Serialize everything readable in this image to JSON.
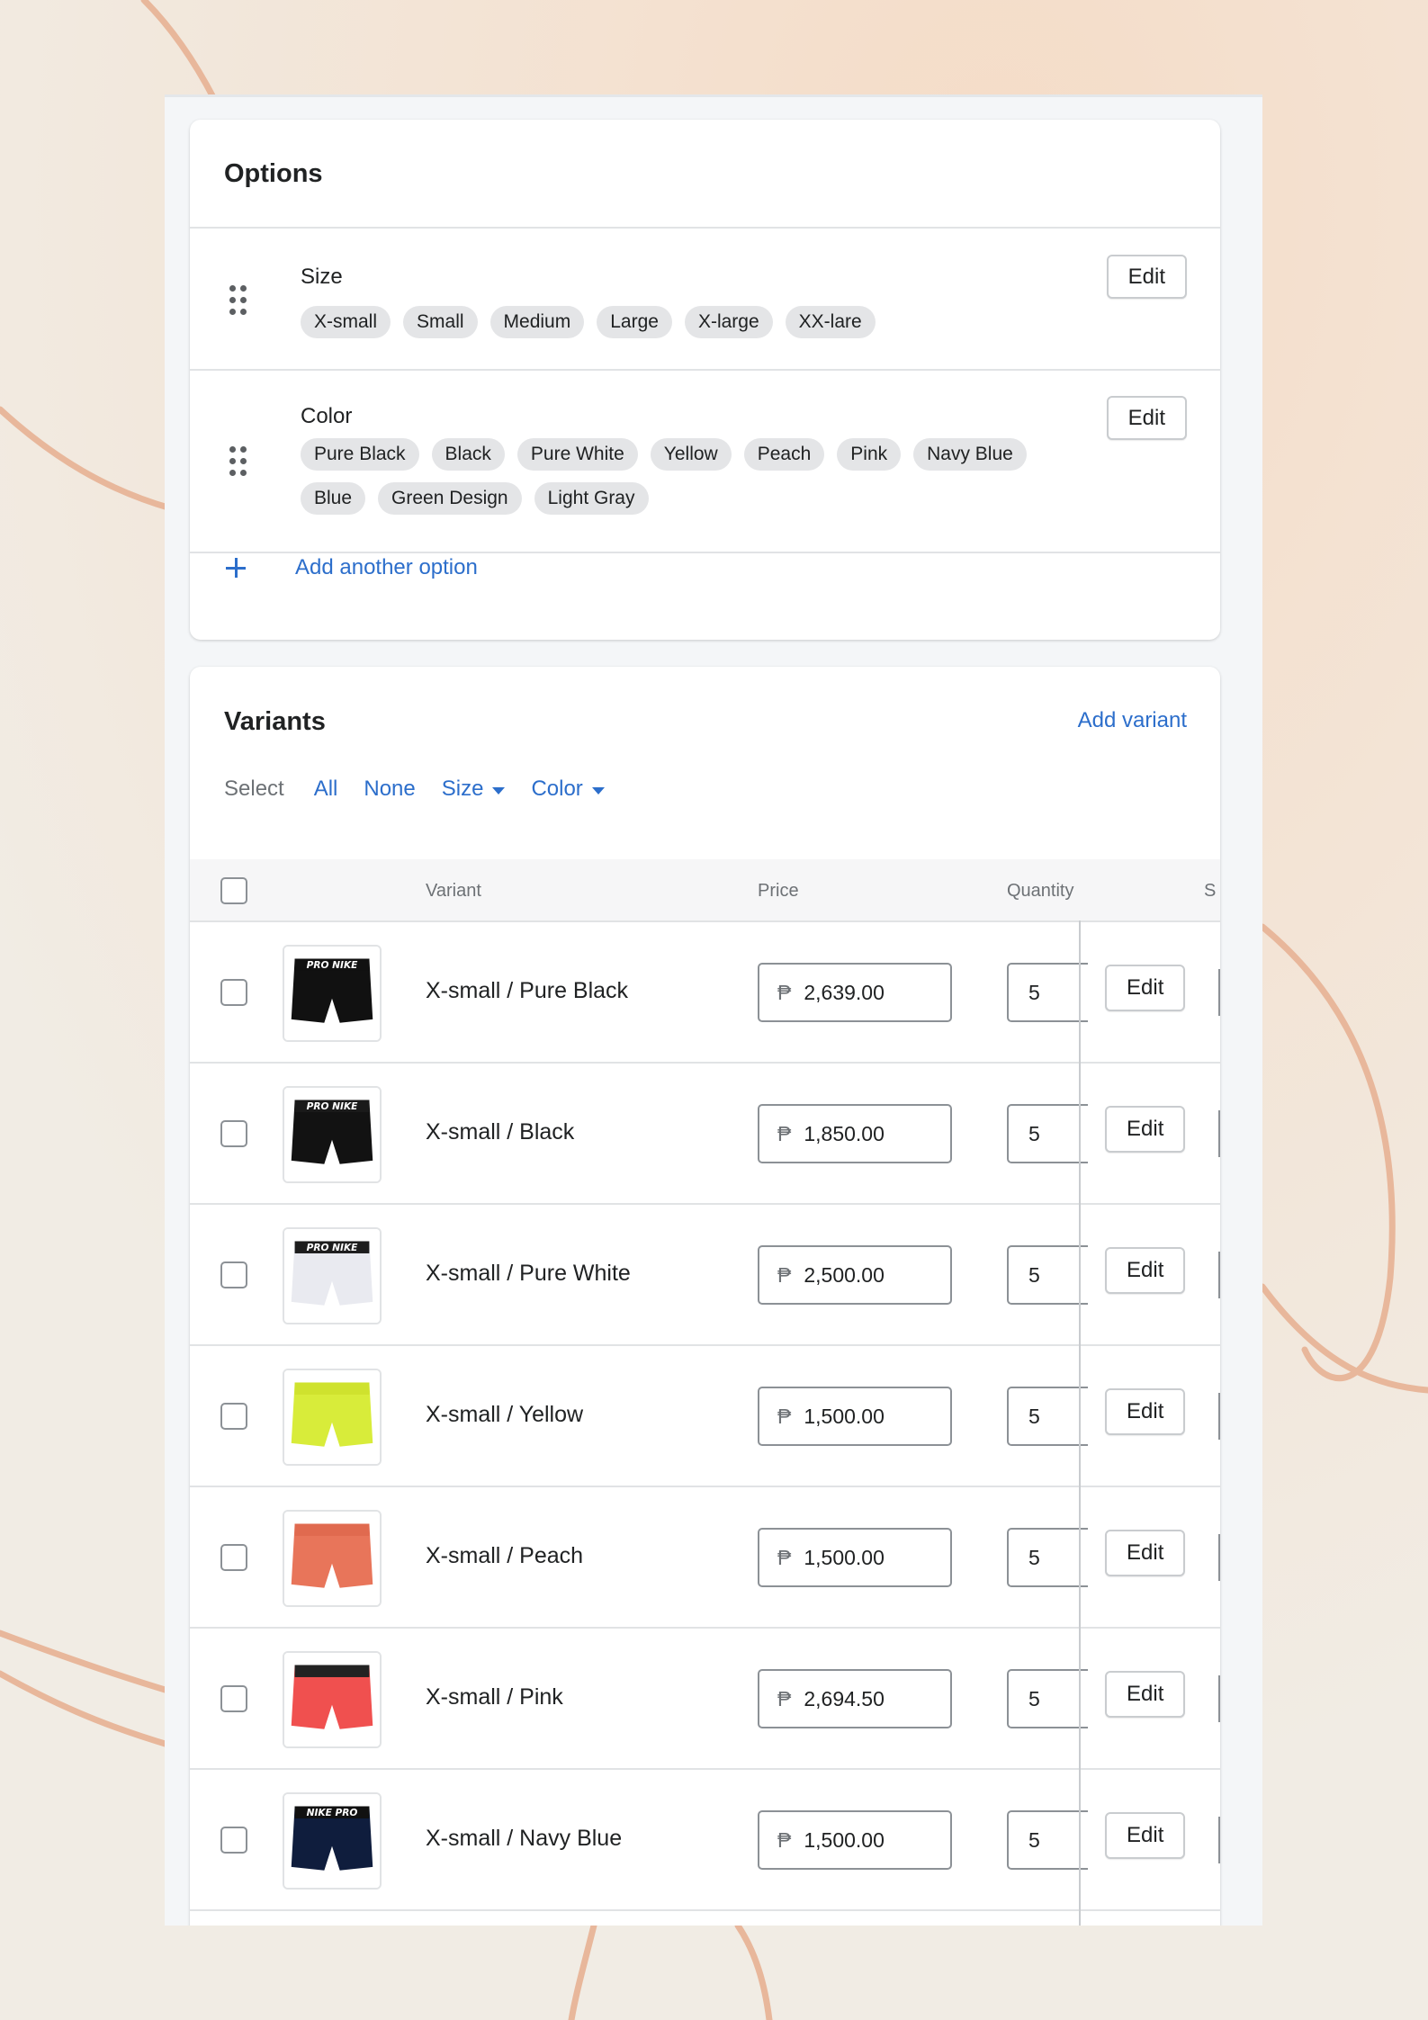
{
  "options": {
    "title": "Options",
    "items": [
      {
        "name": "Size",
        "values": [
          "X-small",
          "Small",
          "Medium",
          "Large",
          "X-large",
          "XX-lare"
        ],
        "edit_label": "Edit"
      },
      {
        "name": "Color",
        "values": [
          "Pure Black",
          "Black",
          "Pure White",
          "Yellow",
          "Peach",
          "Pink",
          "Navy Blue",
          "Blue",
          "Green Design",
          "Light Gray"
        ],
        "edit_label": "Edit"
      }
    ],
    "add_option_label": "Add another option"
  },
  "variants": {
    "title": "Variants",
    "add_variant_label": "Add variant",
    "select": {
      "label": "Select",
      "all": "All",
      "none": "None",
      "size": "Size",
      "color": "Color"
    },
    "columns": {
      "variant": "Variant",
      "price": "Price",
      "quantity": "Quantity",
      "truncated": "S"
    },
    "currency_symbol": "₱",
    "rows": [
      {
        "name": "X-small / Pure Black",
        "price": "2,639.00",
        "quantity": "5",
        "edit_label": "Edit",
        "color": "#111111",
        "band": "#111111",
        "band_text": "PRO NIKE"
      },
      {
        "name": "X-small / Black",
        "price": "1,850.00",
        "quantity": "5",
        "edit_label": "Edit",
        "color": "#121212",
        "band": "#1a1a1a",
        "band_text": "PRO NIKE"
      },
      {
        "name": "X-small / Pure White",
        "price": "2,500.00",
        "quantity": "5",
        "edit_label": "Edit",
        "color": "#e9eaf0",
        "band": "#1d1d1d",
        "band_text": "PRO NIKE"
      },
      {
        "name": "X-small / Yellow",
        "price": "1,500.00",
        "quantity": "5",
        "edit_label": "Edit",
        "color": "#d8ec3a",
        "band": "#cfe22e",
        "band_text": ""
      },
      {
        "name": "X-small / Peach",
        "price": "1,500.00",
        "quantity": "5",
        "edit_label": "Edit",
        "color": "#e8755a",
        "band": "#e06a4f",
        "band_text": ""
      },
      {
        "name": "X-small / Pink",
        "price": "2,694.50",
        "quantity": "5",
        "edit_label": "Edit",
        "color": "#f0504f",
        "band": "#222222",
        "band_text": ""
      },
      {
        "name": "X-small / Navy Blue",
        "price": "1,500.00",
        "quantity": "5",
        "edit_label": "Edit",
        "color": "#0f1d3d",
        "band": "#111111",
        "band_text": "NIKE PRO"
      }
    ]
  },
  "theme": {
    "accent": "#2c6ecb",
    "tag_bg": "#e4e5e7",
    "background": "#f3e5d6",
    "line_color": "#e8b79b"
  }
}
